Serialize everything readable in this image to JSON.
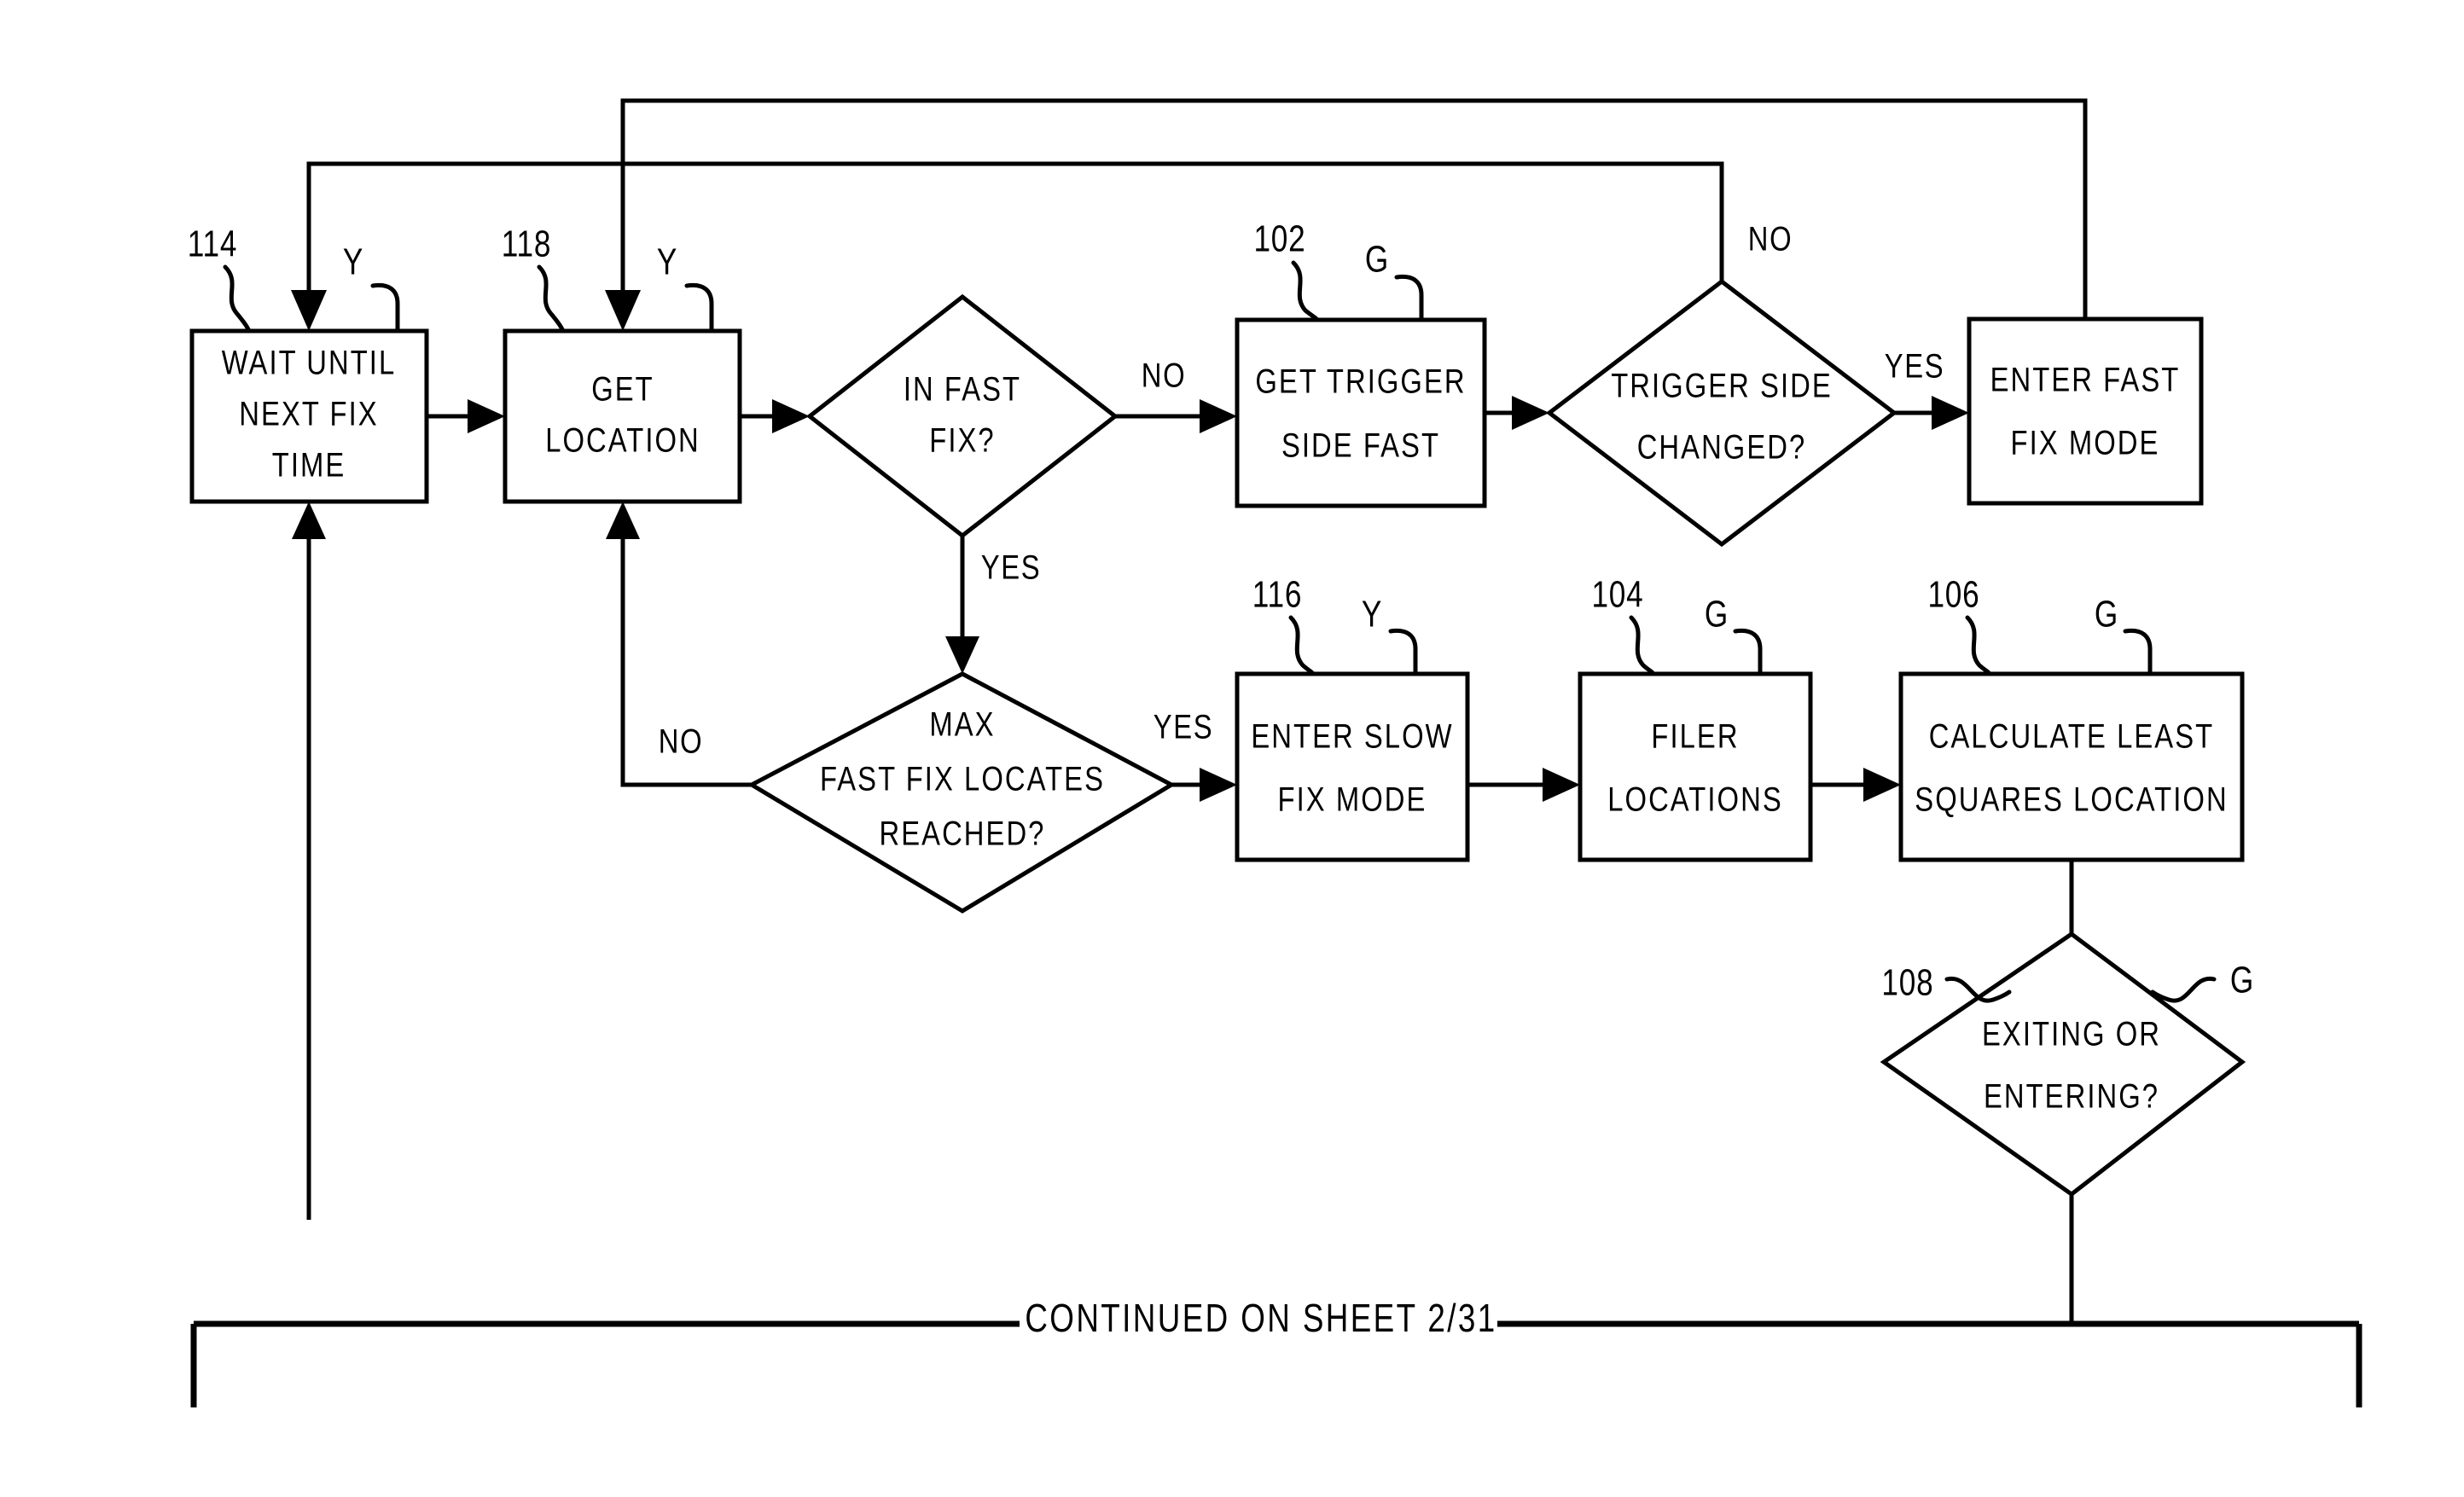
{
  "figure": {
    "sheet_label": "CONTINUED ON SHEET 2/31",
    "background_color": "#ffffff",
    "line_color": "#000000"
  },
  "nodes": {
    "wait_until_next_fix": {
      "ref": "114",
      "port_tag": "Y",
      "line1": "WAIT UNTIL",
      "line2": "NEXT FIX",
      "line3": "TIME",
      "shape": "process"
    },
    "get_location": {
      "ref": "118",
      "port_tag": "Y",
      "line1": "GET",
      "line2": "LOCATION",
      "shape": "process"
    },
    "in_fast_fix": {
      "line1": "IN FAST",
      "line2": "FIX?",
      "shape": "decision"
    },
    "get_trigger_side_fast": {
      "ref": "102",
      "port_tag": "G",
      "line1": "GET TRIGGER",
      "line2": "SIDE FAST",
      "shape": "process"
    },
    "trigger_side_changed": {
      "line1": "TRIGGER SIDE",
      "line2": "CHANGED?",
      "shape": "decision"
    },
    "enter_fast_fix_mode": {
      "line1": "ENTER FAST",
      "line2": "FIX MODE",
      "shape": "process"
    },
    "max_fast_fix_locates_reached": {
      "line1": "MAX",
      "line2": "FAST FIX LOCATES",
      "line3": "REACHED?",
      "shape": "decision"
    },
    "enter_slow_fix_mode": {
      "ref": "116",
      "port_tag": "Y",
      "line1": "ENTER SLOW",
      "line2": "FIX MODE",
      "shape": "process"
    },
    "filer_locations": {
      "ref": "104",
      "port_tag": "G",
      "line1": "FILER",
      "line2": "LOCATIONS",
      "shape": "process"
    },
    "calculate_least_squares_location": {
      "ref": "106",
      "port_tag": "G",
      "line1": "CALCULATE LEAST",
      "line2": "SQUARES LOCATION",
      "shape": "process"
    },
    "exiting_or_entering": {
      "ref": "108",
      "port_tag": "G",
      "line1": "EXITING OR",
      "line2": "ENTERING?",
      "shape": "decision"
    }
  },
  "edge_labels": {
    "in_fast_fix_no": "NO",
    "in_fast_fix_yes": "YES",
    "trigger_side_changed_no": "NO",
    "trigger_side_changed_yes": "YES",
    "max_locates_no": "NO",
    "max_locates_yes": "YES"
  }
}
